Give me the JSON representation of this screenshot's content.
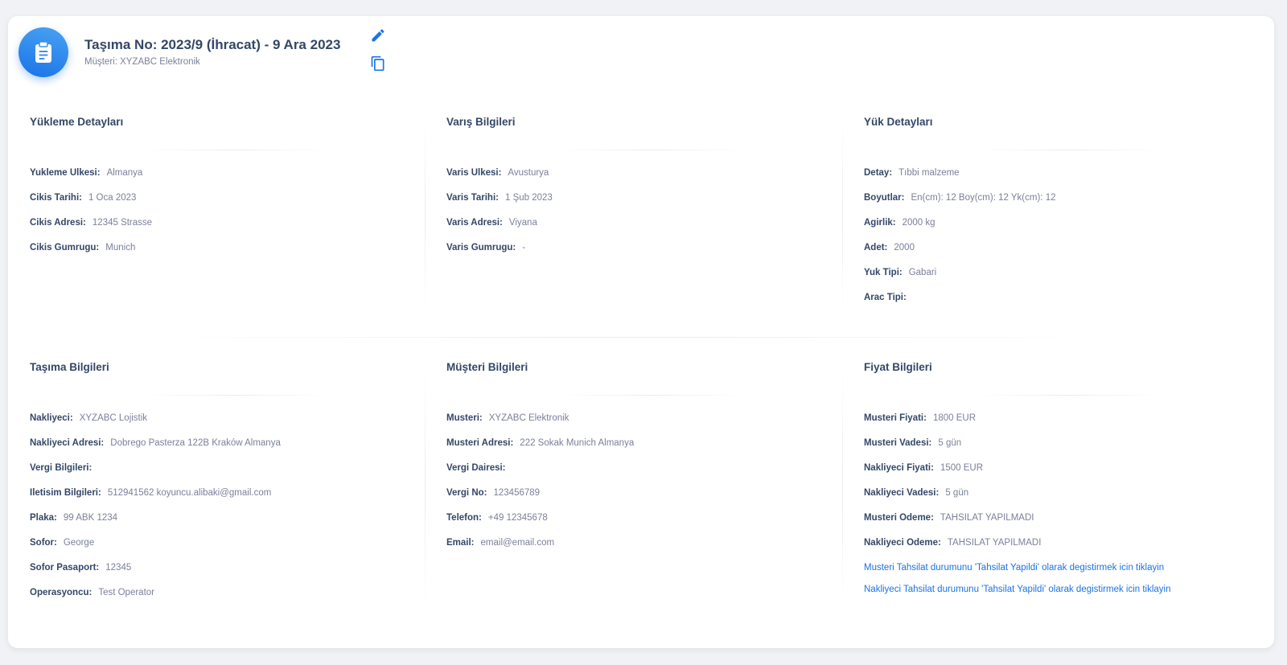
{
  "header": {
    "title": "Taşıma No: 2023/9 (İhracat) - 9 Ara 2023",
    "subtitle": "Müşteri: XYZABC Elektronik",
    "icon": "clipboard-icon",
    "accent_color": "#1a73e8"
  },
  "sections": {
    "yukleme": {
      "title": "Yükleme Detayları",
      "rows": [
        {
          "label": "Yukleme Ulkesi:",
          "value": "Almanya"
        },
        {
          "label": "Cikis Tarihi:",
          "value": "1 Oca 2023"
        },
        {
          "label": "Cikis Adresi:",
          "value": "12345 Strasse"
        },
        {
          "label": "Cikis Gumrugu:",
          "value": "Munich"
        }
      ]
    },
    "varis": {
      "title": "Varış Bilgileri",
      "rows": [
        {
          "label": "Varis Ulkesi:",
          "value": "Avusturya"
        },
        {
          "label": "Varis Tarihi:",
          "value": "1 Şub 2023"
        },
        {
          "label": "Varis Adresi:",
          "value": "Viyana"
        },
        {
          "label": "Varis Gumrugu:",
          "value": "-"
        }
      ]
    },
    "yuk": {
      "title": "Yük Detayları",
      "rows": [
        {
          "label": "Detay:",
          "value": "Tıbbi malzeme"
        },
        {
          "label": "Boyutlar:",
          "value": "En(cm): 12 Boy(cm): 12 Yk(cm): 12"
        },
        {
          "label": "Agirlik:",
          "value": "2000 kg"
        },
        {
          "label": "Adet:",
          "value": "2000"
        },
        {
          "label": "Yuk Tipi:",
          "value": "Gabari"
        },
        {
          "label": "Arac Tipi:",
          "value": ""
        }
      ]
    },
    "tasima": {
      "title": "Taşıma Bilgileri",
      "rows": [
        {
          "label": "Nakliyeci:",
          "value": "XYZABC Lojistik"
        },
        {
          "label": "Nakliyeci Adresi:",
          "value": "Dobrego Pasterza 122B Kraków Almanya"
        },
        {
          "label": "Vergi Bilgileri:",
          "value": ""
        },
        {
          "label": "Iletisim Bilgileri:",
          "value": "512941562 koyuncu.alibaki@gmail.com"
        },
        {
          "label": "Plaka:",
          "value": "99 ABK 1234"
        },
        {
          "label": "Sofor:",
          "value": "George"
        },
        {
          "label": "Sofor Pasaport:",
          "value": "12345"
        },
        {
          "label": "Operasyoncu:",
          "value": "Test Operator"
        }
      ]
    },
    "musteri": {
      "title": "Müşteri Bilgileri",
      "rows": [
        {
          "label": "Musteri:",
          "value": "XYZABC Elektronik"
        },
        {
          "label": "Musteri Adresi:",
          "value": "222 Sokak Munich Almanya"
        },
        {
          "label": "Vergi Dairesi:",
          "value": ""
        },
        {
          "label": "Vergi No:",
          "value": "123456789"
        },
        {
          "label": "Telefon:",
          "value": "+49 12345678"
        },
        {
          "label": "Email:",
          "value": "email@email.com"
        }
      ]
    },
    "fiyat": {
      "title": "Fiyat Bilgileri",
      "rows": [
        {
          "label": "Musteri Fiyati:",
          "value": "1800 EUR"
        },
        {
          "label": "Musteri Vadesi:",
          "value": "5 gün"
        },
        {
          "label": "Nakliyeci Fiyati:",
          "value": "1500 EUR"
        },
        {
          "label": "Nakliyeci Vadesi:",
          "value": "5 gün"
        },
        {
          "label": "Musteri Odeme:",
          "value": "TAHSILAT YAPILMADI"
        },
        {
          "label": "Nakliyeci Odeme:",
          "value": "TAHSILAT YAPILMADI"
        }
      ],
      "links": [
        "Musteri Tahsilat durumunu 'Tahsilat Yapildi' olarak degistirmek icin tiklayin",
        "Nakliyeci Tahsilat durumunu 'Tahsilat Yapildi' olarak degistirmek icin tiklayin"
      ]
    }
  }
}
